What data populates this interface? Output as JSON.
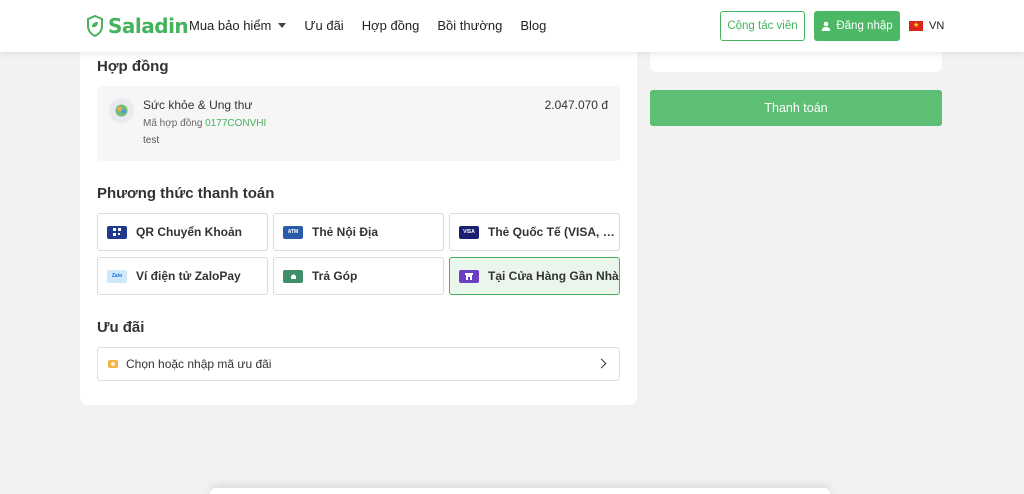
{
  "header": {
    "logo_text": "Saladin",
    "nav": [
      "Mua bảo hiểm",
      "Ưu đãi",
      "Hợp đồng",
      "Bồi thường",
      "Blog"
    ],
    "collaborator_label": "Cộng tác viên",
    "login_label": "Đăng nhập",
    "language": "VN"
  },
  "contract": {
    "section_title": "Hợp đồng",
    "product_name": "Sức khỏe & Ung thư",
    "code_label": "Mã hợp đồng",
    "code_value": "0177CONVHI",
    "note": "test",
    "price": "2.047.070 đ"
  },
  "payment": {
    "section_title": "Phương thức thanh toán",
    "methods": [
      {
        "label": "QR Chuyển Khoản",
        "icon": "qr-icon",
        "color": "#1f3a8a"
      },
      {
        "label": "Thẻ Nội Địa",
        "icon": "atm-card-icon",
        "color": "#2a5caa"
      },
      {
        "label": "Thẻ Quốc Tế (VISA, MASTER, JCB)",
        "icon": "visa-card-icon",
        "color": "#1a1f71"
      },
      {
        "label": "Ví điện tử ZaloPay",
        "icon": "zalopay-icon",
        "color": "#cfe8fa"
      },
      {
        "label": "Trả Góp",
        "icon": "installment-icon",
        "color": "#3f8f6a"
      },
      {
        "label": "Tại Cửa Hàng Gần Nhà",
        "icon": "store-icon",
        "color": "#6b3fc4",
        "selected": true
      }
    ]
  },
  "promo": {
    "section_title": "Ưu đãi",
    "placeholder": "Chọn hoặc nhập mã ưu đãi"
  },
  "sidebar": {
    "pay_button": "Thanh toán"
  },
  "colors": {
    "brand": "#44b35b",
    "pay_button": "#5cbf73"
  }
}
